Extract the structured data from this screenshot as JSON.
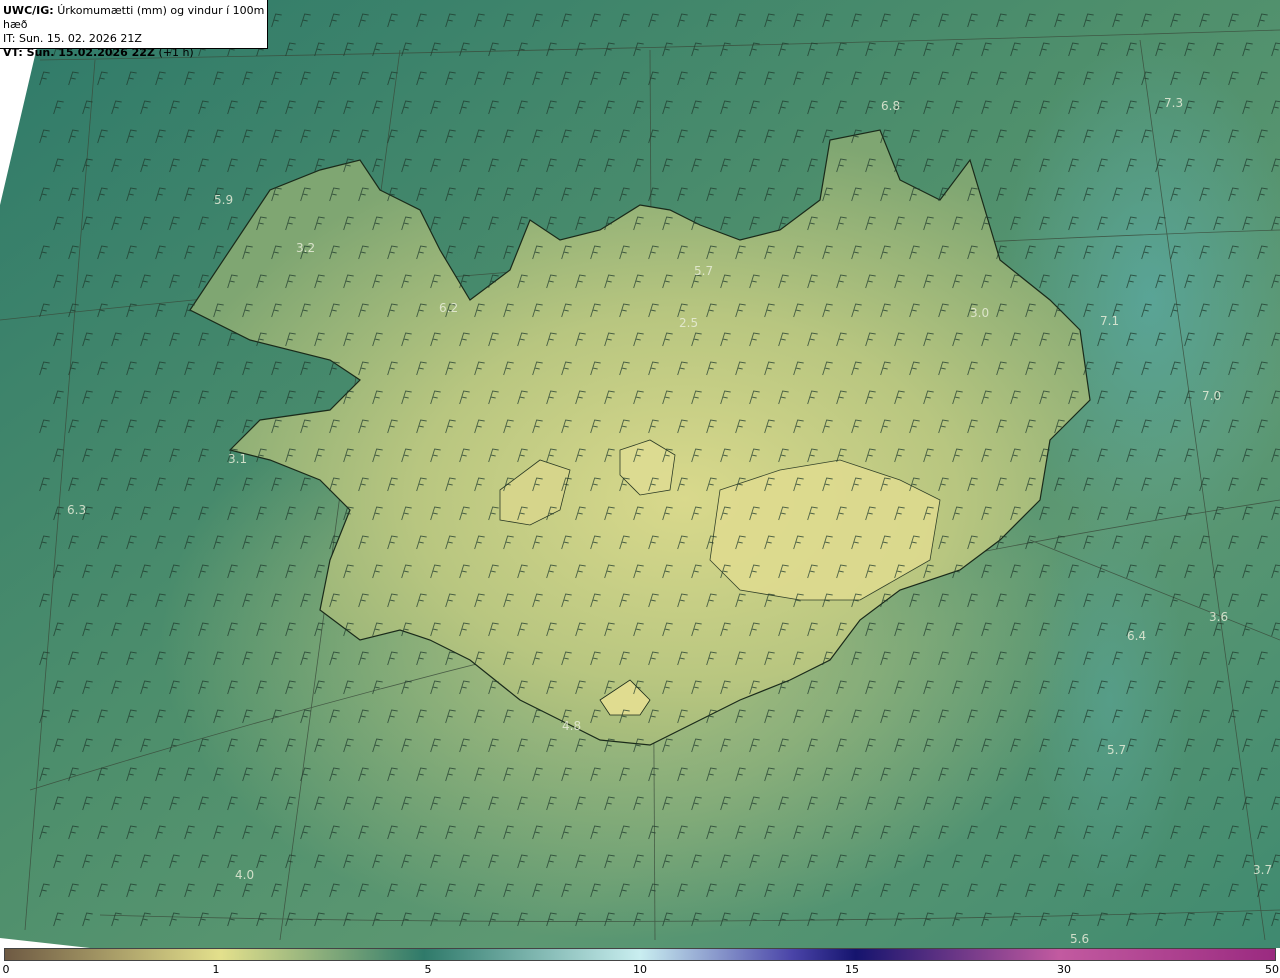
{
  "header": {
    "product": "UWC/IG:",
    "title": "Úrkomumætti (mm) og vindur í 100m hæð",
    "it_line": "IT: Sun. 15. 02. 2026 21Z",
    "vt_label": "VT: Sun. 15.02.2026 22Z",
    "vt_offset": "(+1 h)"
  },
  "legend": {
    "ticks": [
      "0",
      "1",
      "5",
      "10",
      "15",
      "30",
      "50"
    ],
    "tick_positions": [
      0,
      1,
      5,
      10,
      15,
      30,
      50
    ],
    "colors": [
      "#6e5a43",
      "#e3e08c",
      "#2f7a6a",
      "#c9eef0",
      "#4a44a8",
      "#15146e",
      "#c25aa0",
      "#9a2a80"
    ]
  },
  "map": {
    "labels": [
      {
        "text": "5.9"
      },
      {
        "text": "3.2"
      },
      {
        "text": "6.2"
      },
      {
        "text": "5.7"
      },
      {
        "text": "2.5"
      },
      {
        "text": "3.0"
      },
      {
        "text": "6.8"
      },
      {
        "text": "7.3"
      },
      {
        "text": "7.1"
      },
      {
        "text": "7.0"
      },
      {
        "text": "3.1"
      },
      {
        "text": "6.3"
      },
      {
        "text": "4.8"
      },
      {
        "text": "3.6"
      },
      {
        "text": "6.4"
      },
      {
        "text": "5.7"
      },
      {
        "text": "4.0"
      },
      {
        "text": "3.7"
      },
      {
        "text": "5.6"
      }
    ],
    "colors": {
      "ocean": "#3f8a6a",
      "ocean_dark": "#2e7a66",
      "land_low": "#8fb276",
      "land_high": "#d8d88a",
      "coast": "#1a2a1a",
      "barb": "#1f3a2c",
      "grid": "#3a4a3a"
    }
  }
}
